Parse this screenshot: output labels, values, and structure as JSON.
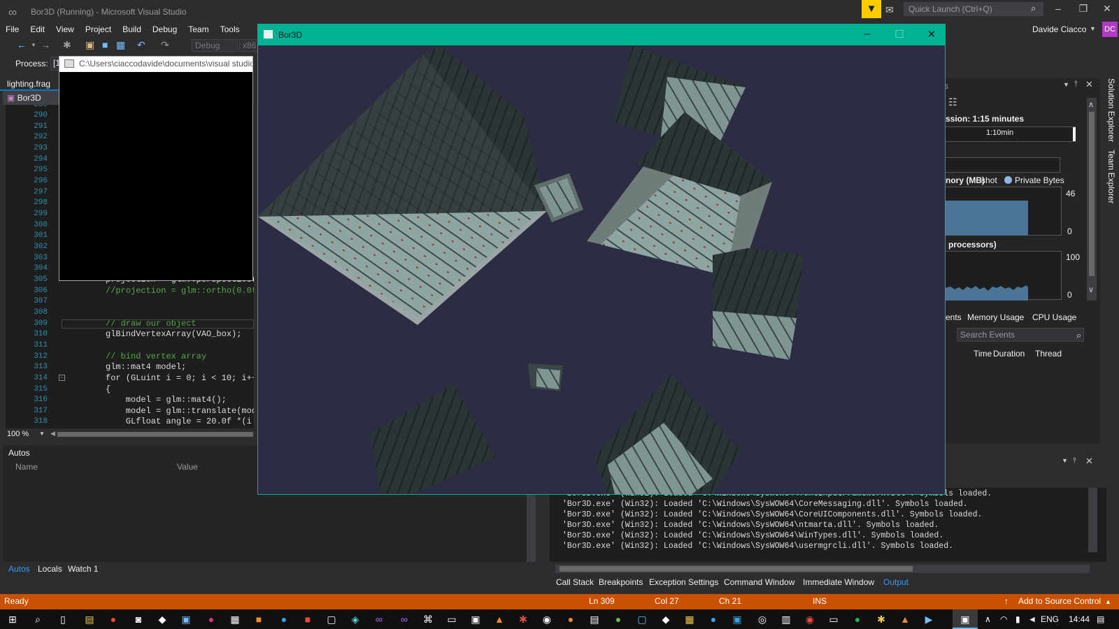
{
  "window": {
    "title": "Bor3D (Running) - Microsoft Visual Studio",
    "quick_launch_placeholder": "Quick Launch (Ctrl+Q)",
    "user_name": "Davide Ciacco",
    "user_initials": "DC"
  },
  "menu": [
    "File",
    "Edit",
    "View",
    "Project",
    "Build",
    "Debug",
    "Team",
    "Tools"
  ],
  "toolbar": {
    "configuration": "Debug",
    "platform": "x86"
  },
  "process_bar": {
    "label": "Process:",
    "value": "[1"
  },
  "editor": {
    "tab_label": "lighting.frag",
    "file_dropdown": "Bor3D",
    "zoom": "100 %",
    "partial_top_line": "289",
    "line_numbers": [
      "290",
      "291",
      "292",
      "293",
      "294",
      "295",
      "296",
      "297",
      "298",
      "299",
      "300",
      "301",
      "302",
      "303",
      "304",
      "305",
      "306",
      "307",
      "308",
      "309",
      "310",
      "311",
      "312",
      "313",
      "314",
      "315",
      "316",
      "317",
      "318"
    ],
    "code_lines": [
      {
        "line": "305",
        "text": "projection = glm::perspective(("
      },
      {
        "line": "306",
        "text": "//projection = glm::ortho(0.0f,"
      },
      {
        "line": "309",
        "text": "// draw our object"
      },
      {
        "line": "310",
        "text": "glBindVertexArray(VAO_box);"
      },
      {
        "line": "312",
        "text": "// bind vertex array"
      },
      {
        "line": "313",
        "text": "glm::mat4 model;"
      },
      {
        "line": "314",
        "text": "for (GLuint i = 0; i < 10; i++)"
      },
      {
        "line": "315",
        "text": "{"
      },
      {
        "line": "316",
        "text": "    model = glm::mat4();"
      },
      {
        "line": "317",
        "text": "    model = glm::translate(mode"
      },
      {
        "line": "318",
        "text": "    GLfloat angle = 20.0f *(i +"
      }
    ]
  },
  "console": {
    "title": "C:\\Users\\ciaccodavide\\documents\\visual studio"
  },
  "gl_window": {
    "title": "Bor3D",
    "background": "#2c2c42",
    "accent": "#00b294"
  },
  "autos": {
    "title": "Autos",
    "col_name": "Name",
    "col_value": "Value",
    "tabs": [
      "Autos",
      "Locals",
      "Watch 1"
    ]
  },
  "output": {
    "partial_first_line": "'Bor3D.exe' (Win32): Loaded 'C:\\Windows\\SysWOW64\\TextInputFramework.dll'. Symbols loaded.",
    "lines": [
      "'Bor3D.exe' (Win32): Loaded 'C:\\Windows\\SysWOW64\\CoreMessaging.dll'. Symbols loaded.",
      "'Bor3D.exe' (Win32): Loaded 'C:\\Windows\\SysWOW64\\CoreUIComponents.dll'. Symbols loaded.",
      "'Bor3D.exe' (Win32): Loaded 'C:\\Windows\\SysWOW64\\ntmarta.dll'. Symbols loaded.",
      "'Bor3D.exe' (Win32): Loaded 'C:\\Windows\\SysWOW64\\WinTypes.dll'. Symbols loaded.",
      "'Bor3D.exe' (Win32): Loaded 'C:\\Windows\\SysWOW64\\usermgrcli.dll'. Symbols loaded."
    ],
    "tabs": [
      "Call Stack",
      "Breakpoints",
      "Exception Settings",
      "Command Window",
      "Immediate Window",
      "Output"
    ],
    "active_tab": "Output"
  },
  "diagnostics": {
    "title_fragment": "s",
    "session": "ssion: 1:15 minutes",
    "timeline_label": "1:10min",
    "memory_label": "nory (MB)",
    "snapshot_label": "shot",
    "private_bytes_label": "Private Bytes",
    "memory_max": "46",
    "memory_min": "0",
    "memory_fill_fraction": 0.71,
    "cpu_label": "processors)",
    "cpu_max": "100",
    "cpu_min": "0",
    "tabs": [
      "ents",
      "Memory Usage",
      "CPU Usage"
    ],
    "search_placeholder": "Search Events",
    "columns": [
      "Time",
      "Duration",
      "Thread"
    ]
  },
  "side_tabs": [
    "Solution Explorer",
    "Team Explorer"
  ],
  "statusbar": {
    "state": "Ready",
    "line": "Ln 309",
    "col": "Col 27",
    "ch": "Ch 21",
    "mode": "INS",
    "source_control": "Add to Source Control",
    "color": "#ca5100"
  },
  "taskbar": {
    "language": "ENG",
    "time": "14:44"
  }
}
